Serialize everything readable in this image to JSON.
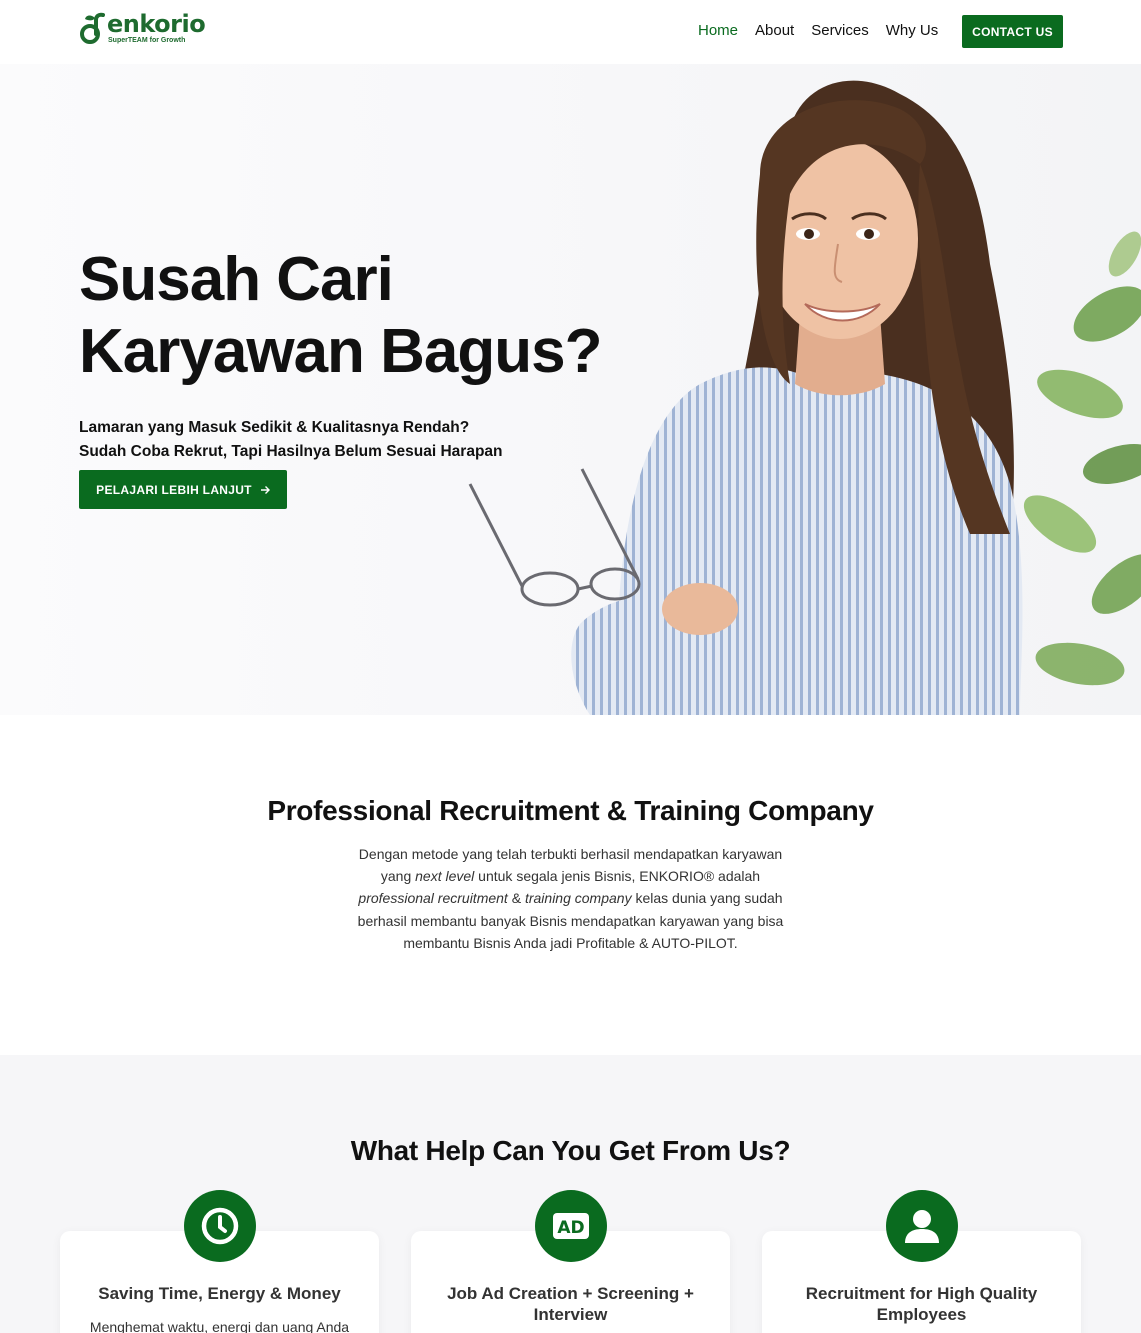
{
  "brand": {
    "name": "enkorio",
    "tagline": "SuperTEAM for Growth",
    "color": "#0a6b1f"
  },
  "nav": {
    "items": [
      {
        "label": "Home",
        "active": true
      },
      {
        "label": "About",
        "active": false
      },
      {
        "label": "Services",
        "active": false
      },
      {
        "label": "Why Us",
        "active": false
      }
    ],
    "cta_label": "CONTACT US"
  },
  "hero": {
    "title_line1": "Susah Cari",
    "title_line2": "Karyawan Bagus?",
    "sub_line1": "Lamaran yang Masuk Sedikit & Kualitasnya Rendah?",
    "sub_line2": "Sudah Coba Rekrut, Tapi Hasilnya Belum Sesuai Harapan",
    "cta_label": "PELAJARI LEBIH LANJUT",
    "cta_icon": "arrow-right-icon"
  },
  "about": {
    "heading": "Professional Recruitment & Training Company",
    "text_part1": "Dengan metode yang telah terbukti berhasil mendapatkan karyawan yang ",
    "text_em1": "next level",
    "text_part2": " untuk segala jenis Bisnis, ENKORIO® adalah ",
    "text_em2": "professional recruitment",
    "text_part3": " & ",
    "text_em3": "training company",
    "text_part4": " kelas dunia yang sudah berhasil membantu banyak Bisnis mendapatkan karyawan yang bisa membantu Bisnis Anda jadi Profitable & AUTO-PILOT."
  },
  "services": {
    "heading": "What Help Can You Get From Us?",
    "cards": [
      {
        "icon": "clock-icon",
        "title": "Saving Time, Energy & Money",
        "desc": "Menghemat waktu, energi dan uang Anda"
      },
      {
        "icon": "ad-icon",
        "title": "Job Ad Creation + Screening + Interview",
        "desc": ""
      },
      {
        "icon": "user-icon",
        "title": "Recruitment for High Quality Employees",
        "desc": ""
      }
    ]
  }
}
